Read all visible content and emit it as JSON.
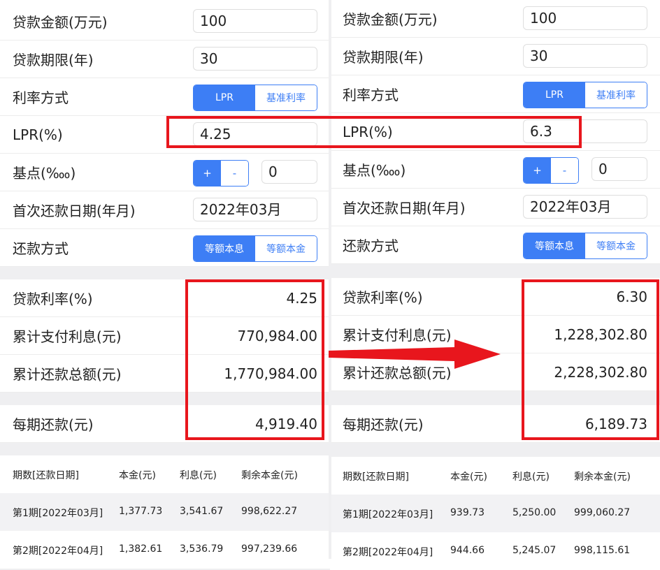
{
  "left": {
    "loan_amount_label": "贷款金额(万元)",
    "loan_amount_value": "100",
    "loan_term_label": "贷款期限(年)",
    "loan_term_value": "30",
    "rate_mode_label": "利率方式",
    "rate_mode_options": [
      "LPR",
      "基准利率"
    ],
    "rate_mode_selected": "LPR",
    "lpr_label": "LPR(%)",
    "lpr_value": "4.25",
    "basis_label": "基点(‱)",
    "basis_plus": "+",
    "basis_minus": "-",
    "basis_value": "0",
    "first_date_label": "首次还款日期(年月)",
    "first_date_value": "2022年03月",
    "repay_mode_label": "还款方式",
    "repay_mode_options": [
      "等额本息",
      "等额本金"
    ],
    "repay_mode_selected": "等额本息",
    "result_rate_label": "贷款利率(%)",
    "result_rate_value": "4.25",
    "total_interest_label": "累计支付利息(元)",
    "total_interest_value": "770,984.00",
    "total_repay_label": "累计还款总额(元)",
    "total_repay_value": "1,770,984.00",
    "monthly_label": "每期还款(元)",
    "monthly_value": "4,919.40",
    "table_headers": [
      "期数[还款日期]",
      "本金(元)",
      "利息(元)",
      "剩余本金(元)"
    ],
    "table_rows": [
      [
        "第1期[2022年03月]",
        "1,377.73",
        "3,541.67",
        "998,622.27"
      ],
      [
        "第2期[2022年04月]",
        "1,382.61",
        "3,536.79",
        "997,239.66"
      ]
    ]
  },
  "right": {
    "loan_amount_label": "贷款金额(万元)",
    "loan_amount_value": "100",
    "loan_term_label": "贷款期限(年)",
    "loan_term_value": "30",
    "rate_mode_label": "利率方式",
    "rate_mode_options": [
      "LPR",
      "基准利率"
    ],
    "rate_mode_selected": "LPR",
    "lpr_label": "LPR(%)",
    "lpr_value": "6.3",
    "basis_label": "基点(‱)",
    "basis_plus": "+",
    "basis_minus": "-",
    "basis_value": "0",
    "first_date_label": "首次还款日期(年月)",
    "first_date_value": "2022年03月",
    "repay_mode_label": "还款方式",
    "repay_mode_options": [
      "等额本息",
      "等额本金"
    ],
    "repay_mode_selected": "等额本息",
    "result_rate_label": "贷款利率(%)",
    "result_rate_value": "6.30",
    "total_interest_label": "累计支付利息(元)",
    "total_interest_value": "1,228,302.80",
    "total_repay_label": "累计还款总额(元)",
    "total_repay_value": "2,228,302.80",
    "monthly_label": "每期还款(元)",
    "monthly_value": "6,189.73",
    "table_headers": [
      "期数[还款日期]",
      "本金(元)",
      "利息(元)",
      "剩余本金(元)"
    ],
    "table_rows": [
      [
        "第1期[2022年03月]",
        "939.73",
        "5,250.00",
        "999,060.27"
      ],
      [
        "第2期[2022年04月]",
        "944.66",
        "5,245.07",
        "998,115.61"
      ]
    ]
  },
  "annotation": {
    "highlight_color": "#e8161d",
    "arrow_color": "#e8161d",
    "accent_color": "#3d7ef5"
  }
}
